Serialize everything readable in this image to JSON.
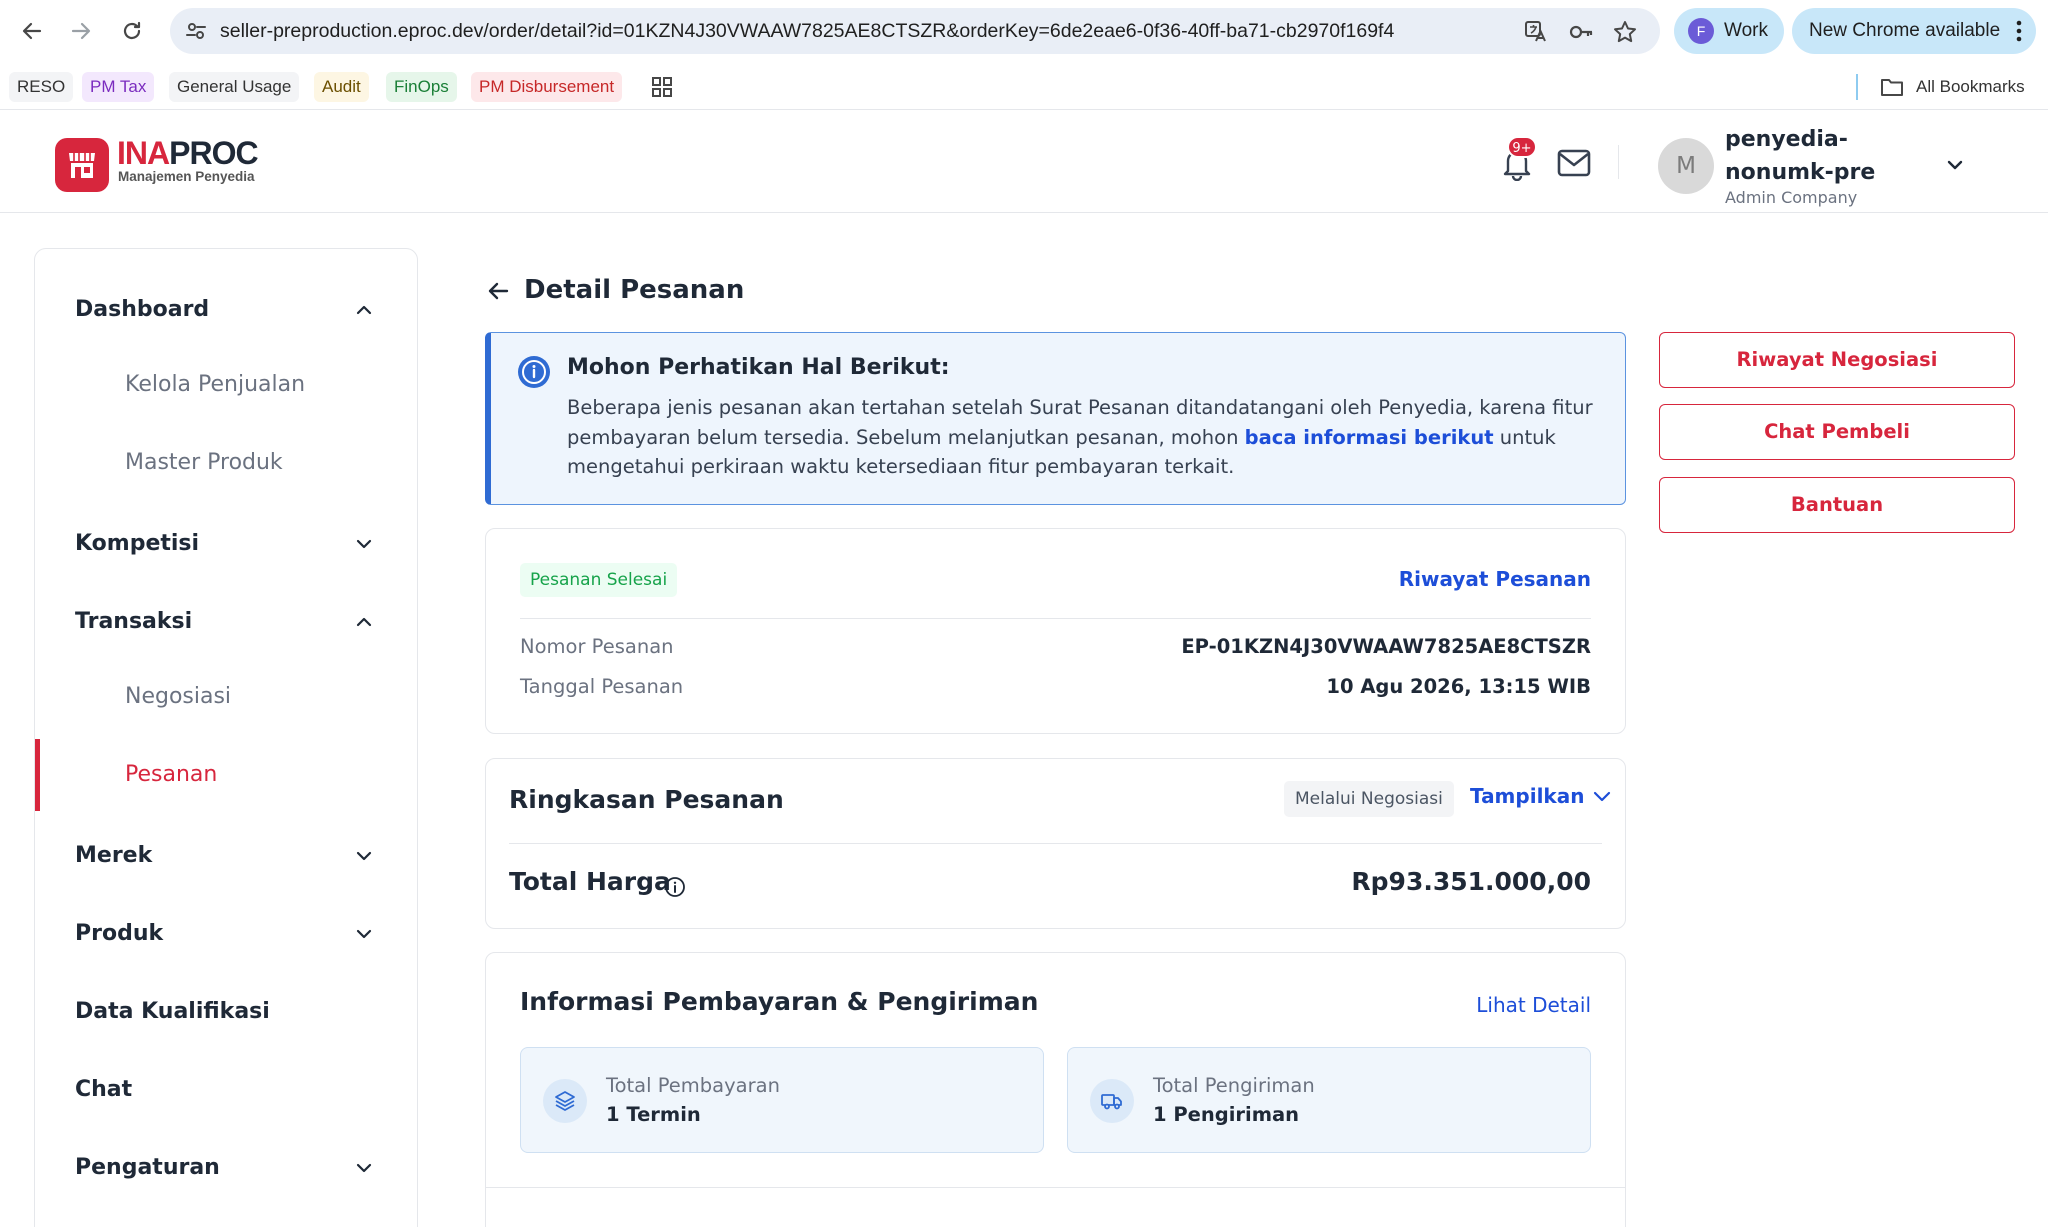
{
  "browser": {
    "url": "seller-preproduction.eproc.dev/order/detail?id=01KZN4J30VWAAW7825AE8CTSZR&orderKey=6de2eae6-0f36-40ff-ba71-cb2970f169f4",
    "profile_initial": "F",
    "profile_label": "Work",
    "update_label": "New Chrome available",
    "bookmarks": [
      {
        "label": "RESO",
        "bg": "#f3f4f6",
        "color": "#333333"
      },
      {
        "label": "PM Tax",
        "bg": "#f3e8fd",
        "color": "#7b2cbf"
      },
      {
        "label": "General Usage",
        "bg": "#f3f4f6",
        "color": "#333333"
      },
      {
        "label": "Audit",
        "bg": "#fdf6e3",
        "color": "#6b4f00"
      },
      {
        "label": "FinOps",
        "bg": "#e6f6ea",
        "color": "#1a7f37"
      },
      {
        "label": "PM Disbursement",
        "bg": "#fde8ea",
        "color": "#c62828"
      }
    ],
    "all_bookmarks": "All Bookmarks"
  },
  "header": {
    "logo_part1": "INA",
    "logo_part2": "PROC",
    "logo_subtitle": "Manajemen Penyedia",
    "notif_badge": "9+",
    "user_initial": "M",
    "user_name": "penyedia-nonumk-pre",
    "user_role": "Admin Company"
  },
  "sidebar": {
    "dashboard": "Dashboard",
    "kelola_penjualan": "Kelola Penjualan",
    "master_produk": "Master Produk",
    "kompetisi": "Kompetisi",
    "transaksi": "Transaksi",
    "negosiasi": "Negosiasi",
    "pesanan": "Pesanan",
    "merek": "Merek",
    "produk": "Produk",
    "data_kualifikasi": "Data Kualifikasi",
    "chat": "Chat",
    "pengaturan": "Pengaturan"
  },
  "page": {
    "title": "Detail Pesanan"
  },
  "alert": {
    "title": "Mohon Perhatikan Hal Berikut:",
    "body_before": "Beberapa jenis pesanan akan tertahan setelah Surat Pesanan ditandatangani oleh Penyedia, karena fitur pembayaran belum tersedia. Sebelum melanjutkan pesanan, mohon ",
    "link": "baca informasi berikut",
    "body_after": " untuk mengetahui perkiraan waktu ketersediaan fitur pembayaran terkait."
  },
  "order": {
    "status": "Pesanan Selesai",
    "history_link": "Riwayat Pesanan",
    "number_label": "Nomor Pesanan",
    "number_value": "EP-01KZN4J30VWAAW7825AE8CTSZR",
    "date_label": "Tanggal Pesanan",
    "date_value": "10 Agu 2026, 13:15 WIB"
  },
  "summary": {
    "title": "Ringkasan Pesanan",
    "badge": "Melalui Negosiasi",
    "toggle": "Tampilkan",
    "total_label": "Total Harga",
    "total_value": "Rp93.351.000,00"
  },
  "payment": {
    "title": "Informasi Pembayaran & Pengiriman",
    "detail_link": "Lihat Detail",
    "payment_label": "Total Pembayaran",
    "payment_value": "1 Termin",
    "shipping_label": "Total Pengiriman",
    "shipping_value": "1 Pengiriman"
  },
  "actions": {
    "riwayat_negosiasi": "Riwayat Negosiasi",
    "chat_pembeli": "Chat Pembeli",
    "bantuan": "Bantuan"
  },
  "colors": {
    "brand_red": "#d7263d",
    "link_blue": "#1d4ed8",
    "success_green": "#16a34a",
    "alert_blue": "#2f6bd3"
  }
}
